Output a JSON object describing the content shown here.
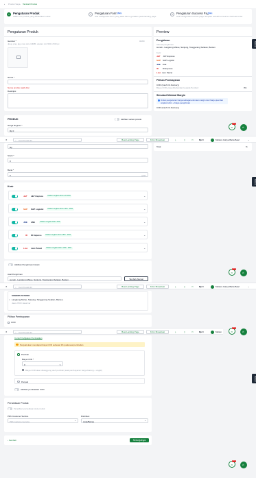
{
  "breadcrumb": {
    "parent": "Produk Saya",
    "current": "Tambah Produk"
  },
  "steps": [
    {
      "title": "Pengaturan Produk",
      "desc": "Isikan info produk yang dibutuhkan untuk",
      "badge": ""
    },
    {
      "title": "Pengaturan Form",
      "badge": "Baru",
      "desc": "Atur konfigurasi Form yang akan kamu gunakan pada landing page"
    },
    {
      "title": "Pengaturan Success Page",
      "badge": "Baru",
      "desc": "Atur konfigurasi success page tampilan setelah konsumen berhasil order"
    }
  ],
  "left": {
    "title": "Pengaturan Produk",
    "gambar_label": "Gambar *",
    "gambar_counter": "00/80",
    "gambar_hint": "Jpeg, png, jpg, max size 10MB, ukuran min 500 x 500 px",
    "nama_label": "Nama *",
    "nama_error": "Nama produk wajib diisi",
    "deskripsi_label": "Deskripsi",
    "produk_heading": "PRODUK",
    "variasi_label": "Aktifkan variasi produk",
    "harga_label": "Harga Reguler *",
    "harga_value": "Rp 0",
    "stok_label": "Stock *",
    "stok_value": "0",
    "berat_label": "Berat *",
    "berat_value": "0",
    "berat_unit": "gram"
  },
  "toolbar": {
    "search_placeholder": "Cari Produk ID",
    "landing_btn": "Buat Landing Page",
    "broadcast_btn": "Kirim Broadcast",
    "balance": "Rp 0",
    "user": "Mutiara Cahya Batra Basri"
  },
  "ekspedisi": {
    "heading": "Kurir",
    "items": [
      {
        "name": "J&T Express",
        "badge": "Diskon ongkos kirim s/d 10%"
      },
      {
        "name": "SAP Logistic",
        "badge": "Diskon ongkos kirim 13% - 35%"
      },
      {
        "name": "JNE",
        "badge": "Diskon ongkos kirim 15%"
      },
      {
        "name": "ID Express",
        "badge": "Diskon ongkos kirim 15% - 20%"
      },
      {
        "name": "Lion Parcel",
        "badge": "Diskon ongkos kirim 10% - 25%"
      }
    ],
    "instant_label": "Aktifkan Pengiriman Instant",
    "origin_label": "Asal Pengiriman",
    "origin_value": "sumali - Langkong Mulue, Sanjung, Tanggerang Selatan, Banten",
    "add_address": "Tambah Alamat"
  },
  "address_card": {
    "name": "SOBEMS STARDO",
    "line": "Langkong Mulue, Sanjung, Tanggerang Selatan, Banten,",
    "sub": "Jawa 7000 Jawa bar"
  },
  "pembayaran": {
    "heading": "Pilihan Pembayaran",
    "cod": "COD",
    "link": "Contoh Kebijakan Pembatalan",
    "info": "Penjual akan mendapat biaya COD sebesar 4% pada saat pembelian",
    "opt1": "Pembeli",
    "biaya_label": "Biaya COD *",
    "biaya_value": "0",
    "biaya_unit": "%",
    "biaya_note": "Biaya COD akan ditanggung oleh pembeli (saat pembayaran harga barang + ongkir)",
    "opt2": "Penjual",
    "pembatalan": "Aktifkan pembatalan COD"
  },
  "persediaan": {
    "heading": "Persediaan Produk",
    "toggle_label": "Tampilkan persediaan stok produk",
    "cs_label": "Pilih Customer Service",
    "cs_placeholder": "Pilih customer service",
    "dist_label": "Distribusi",
    "dist_value": "Acak/Bebas"
  },
  "footer": {
    "back": "Kembali",
    "save": "Selanjutnya"
  },
  "preview": {
    "title": "Preview",
    "pengiriman": "Pengiriman",
    "alamat_label": "Alamat pengiriman",
    "alamat_value": "sumali - Langkong Mulue, Sanjung, Tanggerang Selatan, Banten",
    "kurir_label": "Kurir",
    "kurir": [
      "J&T Express",
      "SAP Logistic",
      "JNE",
      "ID Express",
      "Lion Parcel"
    ],
    "pembayaran_heading": "Pilihan Pembayaran",
    "cod_title": "COD (Cash On Delivery)",
    "cod_desc": "Biaya COD yang dibebankan kepada Pembeli",
    "cod_pct": "0%",
    "simulasi": "Simulasi Minimal Margin",
    "simulasi_info": "Untuk pengaturan harga sebagai estimasi margin dari harga jual dan ongkos kirim + biaya pengiriman",
    "cod_small": "COD (Cash On Delivery)",
    "total_label": "Total",
    "total_pct": "%"
  },
  "side_tab": "Bantuan",
  "fab_badge": "99+"
}
